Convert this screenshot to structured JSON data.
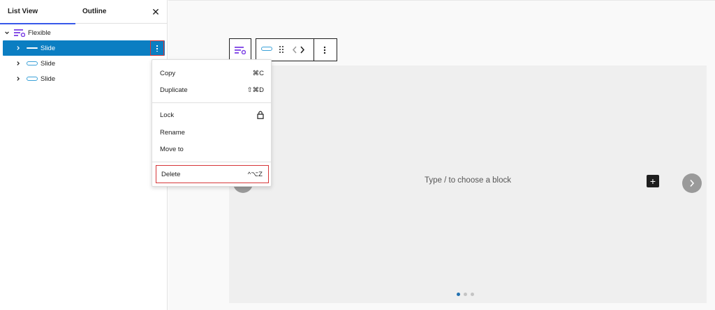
{
  "sidebar": {
    "tabs": [
      {
        "label": "List View"
      },
      {
        "label": "Outline"
      }
    ],
    "close_icon": "close-icon",
    "tree": {
      "root": {
        "label": "Flexible",
        "icon": "flexible-slider-icon"
      },
      "items": [
        {
          "label": "Slide",
          "selected": true
        },
        {
          "label": "Slide",
          "selected": false
        },
        {
          "label": "Slide",
          "selected": false
        }
      ]
    }
  },
  "context_menu": {
    "items": [
      {
        "label": "Copy",
        "shortcut": "⌘C"
      },
      {
        "label": "Duplicate",
        "shortcut": "⇧⌘D"
      },
      {
        "label": "Lock",
        "shortcut_icon": "lock-icon"
      },
      {
        "label": "Rename"
      },
      {
        "label": "Move to"
      },
      {
        "label": "Delete",
        "shortcut": "^⌥Z"
      }
    ]
  },
  "editor": {
    "placeholder": "Type / to choose a block",
    "add_label": "+",
    "dots": 3,
    "active_dot": 0
  },
  "colors": {
    "selected_row": "#0b7ec2",
    "highlight_border": "#d63638",
    "accent": "#3858e9",
    "block_icon": "#7b3fe4"
  }
}
